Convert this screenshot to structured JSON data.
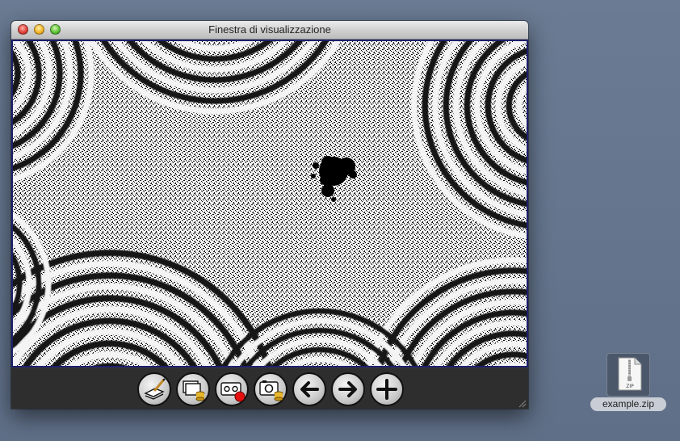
{
  "window": {
    "title": "Finestra di visualizzazione",
    "controls": [
      "close",
      "minimize",
      "zoom"
    ]
  },
  "canvas": {
    "content": "fractal-render",
    "colors": {
      "frame_border": "#1c1f6b",
      "set": "#000000",
      "band_light": "#ffffff",
      "band_dark": "#111111"
    }
  },
  "toolbar": {
    "buttons": [
      {
        "icon": "brush-icon"
      },
      {
        "icon": "save-layers-icon"
      },
      {
        "icon": "record-video-icon"
      },
      {
        "icon": "save-snapshot-icon"
      },
      {
        "icon": "arrow-left-icon"
      },
      {
        "icon": "arrow-right-icon"
      },
      {
        "icon": "plus-icon"
      }
    ]
  },
  "desktop": {
    "file": {
      "name": "example.zip",
      "badge": "ZIP",
      "icon": "zip-archive-icon"
    }
  }
}
